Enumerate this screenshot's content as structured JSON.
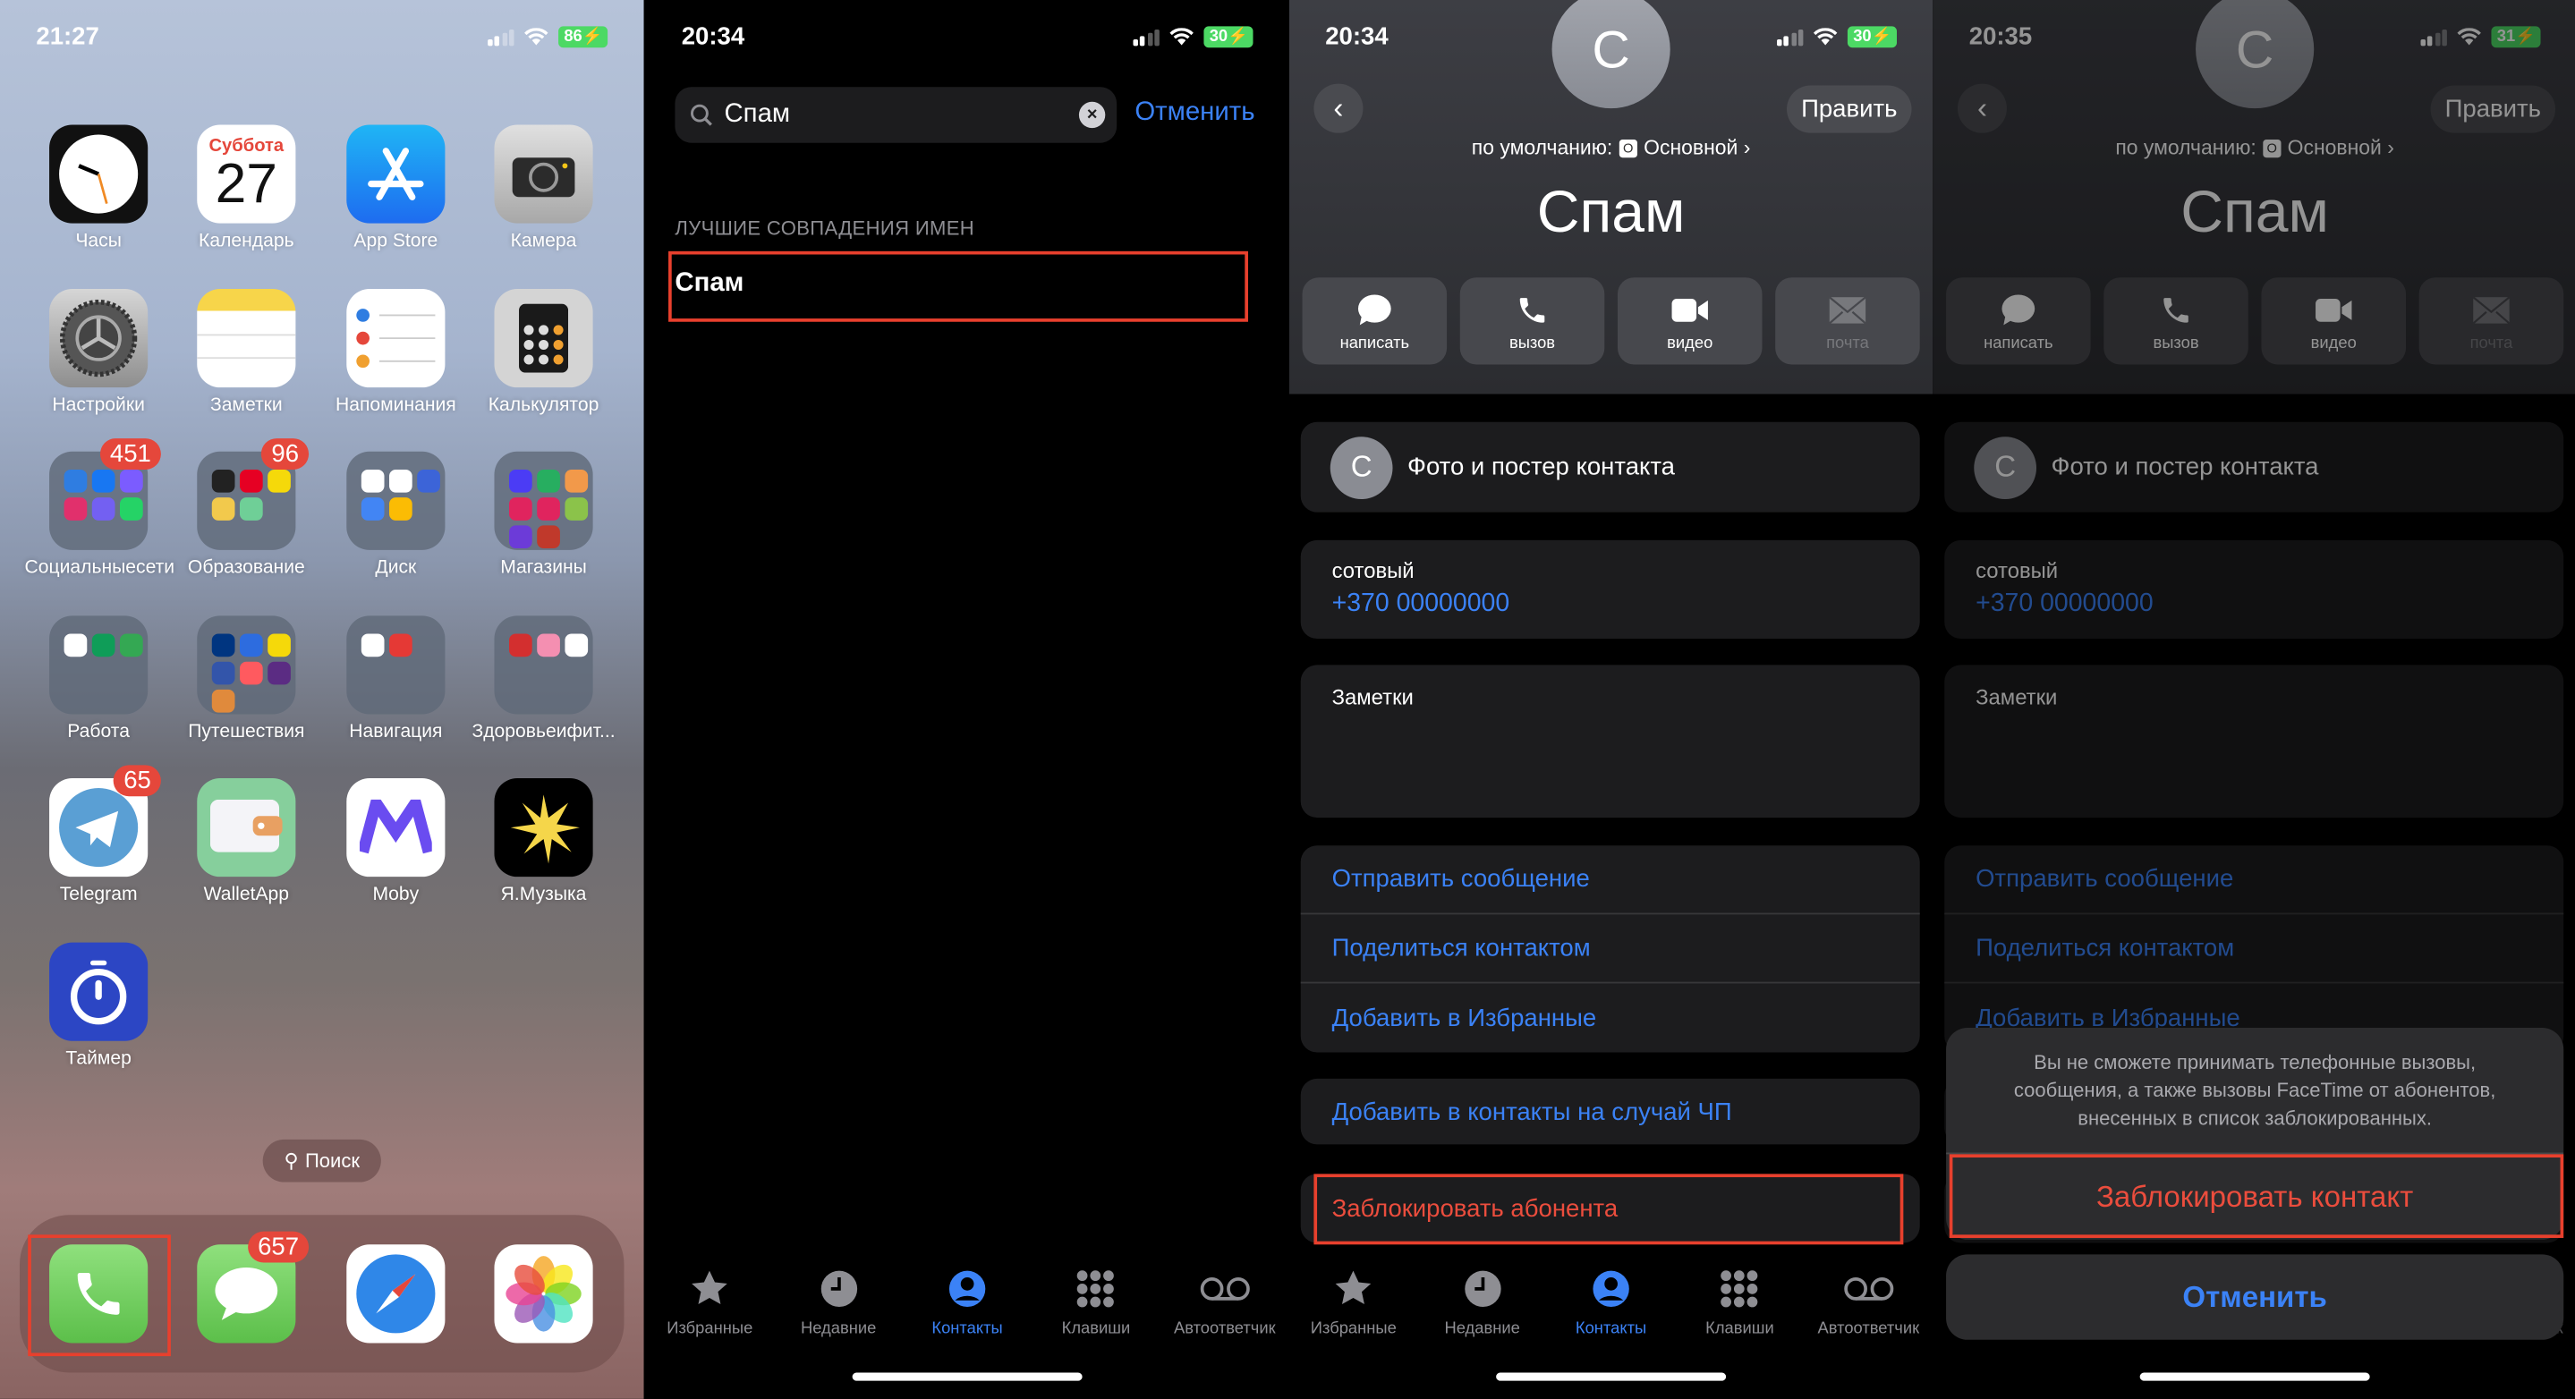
{
  "home": {
    "status": {
      "time": "21:27",
      "battery": "86"
    },
    "apps": [
      {
        "name": "Часы",
        "icon": "clock"
      },
      {
        "name": "Календарь",
        "icon": "calendar",
        "day": "Суббота",
        "date": "27"
      },
      {
        "name": "App Store",
        "icon": "appstore"
      },
      {
        "name": "Камера",
        "icon": "camera"
      },
      {
        "name": "Настройки",
        "icon": "settings"
      },
      {
        "name": "Заметки",
        "icon": "notes"
      },
      {
        "name": "Напоминания",
        "icon": "reminders"
      },
      {
        "name": "Калькулятор",
        "icon": "calculator"
      },
      {
        "name": "Социальныесети",
        "icon": "folder",
        "badge": "451",
        "colors": [
          "#2f7de1",
          "#1877f2",
          "#7b5cff",
          "#e1306c",
          "#7360f2",
          "#25d366"
        ]
      },
      {
        "name": "Образование",
        "icon": "folder",
        "badge": "96",
        "colors": [
          "#222",
          "#e60023",
          "#f5d90a",
          "#f2c94c",
          "#6fcf97"
        ]
      },
      {
        "name": "Диск",
        "icon": "folder",
        "colors": [
          "#fff",
          "#fff",
          "#3c64d8",
          "#4285f4",
          "#fbbc04"
        ]
      },
      {
        "name": "Магазины",
        "icon": "folder",
        "colors": [
          "#4b3cf5",
          "#27ae60",
          "#f2994a",
          "#e0245e",
          "#e0245e",
          "#8bc34a",
          "#6c3bd8",
          "#c0392b"
        ]
      },
      {
        "name": "Работа",
        "icon": "folder",
        "colors": [
          "#fff",
          "#0f9d58",
          "#34a853"
        ]
      },
      {
        "name": "Путешествия",
        "icon": "folder",
        "colors": [
          "#003580",
          "#2d6cdf",
          "#f5d90a",
          "#3355aa",
          "#ff5a5f",
          "#5b2c83",
          "#e08a3c"
        ]
      },
      {
        "name": "Навигация",
        "icon": "folder",
        "colors": [
          "#fff",
          "#e53935"
        ]
      },
      {
        "name": "Здоровьеифит...",
        "icon": "folder",
        "colors": [
          "#d32f2f",
          "#f48fb1",
          "#fff"
        ]
      },
      {
        "name": "Telegram",
        "icon": "telegram",
        "badge": "65"
      },
      {
        "name": "WalletApp",
        "icon": "wallet"
      },
      {
        "name": "Moby",
        "icon": "moby"
      },
      {
        "name": "Я.Музыка",
        "icon": "yamusic"
      },
      {
        "name": "Таймер",
        "icon": "timer"
      }
    ],
    "search_label": "Поиск",
    "dock": [
      {
        "name": "Телефон",
        "icon": "phone"
      },
      {
        "name": "Сообщения",
        "icon": "messages",
        "badge": "657"
      },
      {
        "name": "Safari",
        "icon": "safari"
      },
      {
        "name": "Фото",
        "icon": "photos"
      }
    ]
  },
  "search": {
    "status": {
      "time": "20:34",
      "battery": "30"
    },
    "query": "Спам",
    "cancel": "Отменить",
    "section_header": "ЛУЧШИЕ СОВПАДЕНИЯ ИМЕН",
    "result": "Спам"
  },
  "tabs": [
    {
      "label": "Избранные",
      "icon": "star"
    },
    {
      "label": "Недавние",
      "icon": "clock"
    },
    {
      "label": "Контакты",
      "icon": "person-circle",
      "active": true
    },
    {
      "label": "Клавиши",
      "icon": "keypad"
    },
    {
      "label": "Автоответчик",
      "icon": "voicemail"
    }
  ],
  "contact": {
    "status": {
      "time": "20:34",
      "battery": "30"
    },
    "initial": "С",
    "edit": "Править",
    "default_label": "по умолчанию:",
    "default_badge": "О",
    "default_value": "Основной",
    "name": "Спам",
    "actions": [
      {
        "label": "написать",
        "icon": "message"
      },
      {
        "label": "вызов",
        "icon": "phone"
      },
      {
        "label": "видео",
        "icon": "video"
      },
      {
        "label": "почта",
        "icon": "mail",
        "disabled": true
      }
    ],
    "poster": "Фото и постер контакта",
    "phone_label": "сотовый",
    "phone": "+370 00000000",
    "notes_label": "Заметки",
    "links": [
      "Отправить сообщение",
      "Поделиться контактом",
      "Добавить в Избранные"
    ],
    "emergency": "Добавить в контакты на случай ЧП",
    "block": "Заблокировать абонента"
  },
  "confirm": {
    "status": {
      "time": "20:35",
      "battery": "31"
    },
    "message": "Вы не сможете принимать телефонные вызовы, сообщения, а также вызовы FaceTime от абонентов, внесенных в список заблокированных.",
    "block": "Заблокировать контакт",
    "cancel": "Отменить"
  },
  "colors": {
    "accent": "#3b82f6",
    "destructive": "#eb4d3d",
    "highlight_box": "#e8402d"
  }
}
